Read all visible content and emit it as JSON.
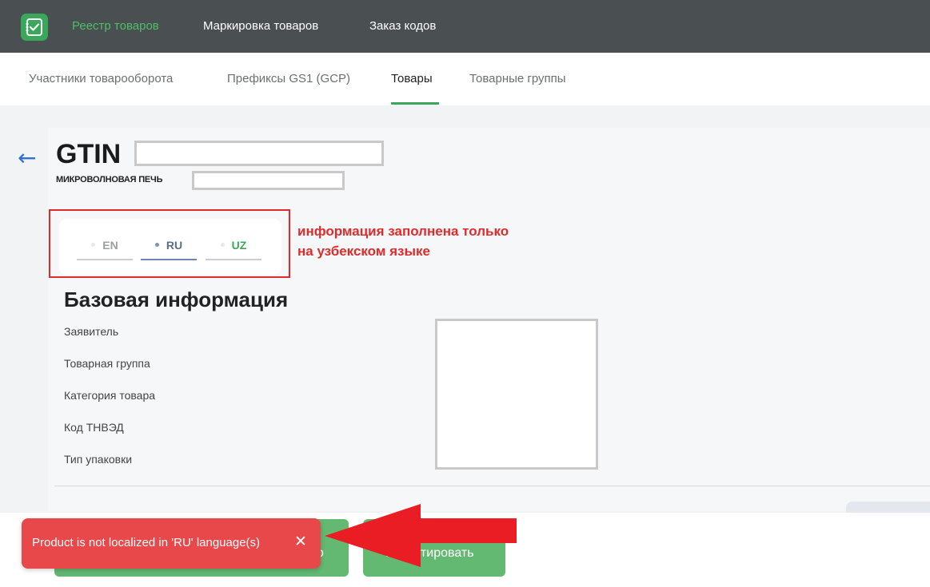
{
  "topbar": {
    "logo_icon": "checklist-icon",
    "nav": [
      {
        "label": "Реестр товаров",
        "active": true
      },
      {
        "label": "Маркировка товаров",
        "active": false
      },
      {
        "label": "Заказ кодов",
        "active": false
      }
    ]
  },
  "subnav": {
    "tabs": [
      {
        "label": "Участники товарооборота",
        "active": false
      },
      {
        "label": "Префиксы GS1 (GCP)",
        "active": false
      },
      {
        "label": "Товары",
        "active": true
      },
      {
        "label": "Товарные группы",
        "active": false
      }
    ]
  },
  "product": {
    "back_icon": "arrow-left-icon",
    "gtin_label": "GTIN",
    "gtin_value": "",
    "name": "МИКРОВОЛНОВАЯ ПЕЧЬ",
    "name_suffix": ""
  },
  "languages": {
    "tabs": [
      {
        "label": "EN",
        "color": "#9aa0a6",
        "dot_color": "#e6e8ea",
        "line_color": "#c9ced4"
      },
      {
        "label": "RU",
        "color": "#5c6f8a",
        "dot_color": "#7f93b3",
        "line_color": "#6f87b0"
      },
      {
        "label": "UZ",
        "color": "#3aa85a",
        "dot_color": "#e6e8ea",
        "line_color": "#c9ced4"
      }
    ]
  },
  "annotation": {
    "line1": "информация заполнена только",
    "line2": "на узбекском языке",
    "color": "#e02b2b"
  },
  "basic_info": {
    "title": "Базовая информация",
    "fields": [
      {
        "label": "Заявитель"
      },
      {
        "label": "Товарная группа"
      },
      {
        "label": "Категория товара"
      },
      {
        "label": "Код ТНВЭД"
      },
      {
        "label": "Тип упаковки"
      }
    ]
  },
  "actions": {
    "left_button_partial": "о",
    "edit_button": "Редактировать"
  },
  "toast": {
    "message": "Product is not localized in 'RU' language(s)",
    "close_icon": "close-icon",
    "color": "#e8484a"
  },
  "colors": {
    "accent_green": "#3aa85a",
    "topbar": "#4a4f52",
    "link_blue": "#2f6fd6"
  }
}
